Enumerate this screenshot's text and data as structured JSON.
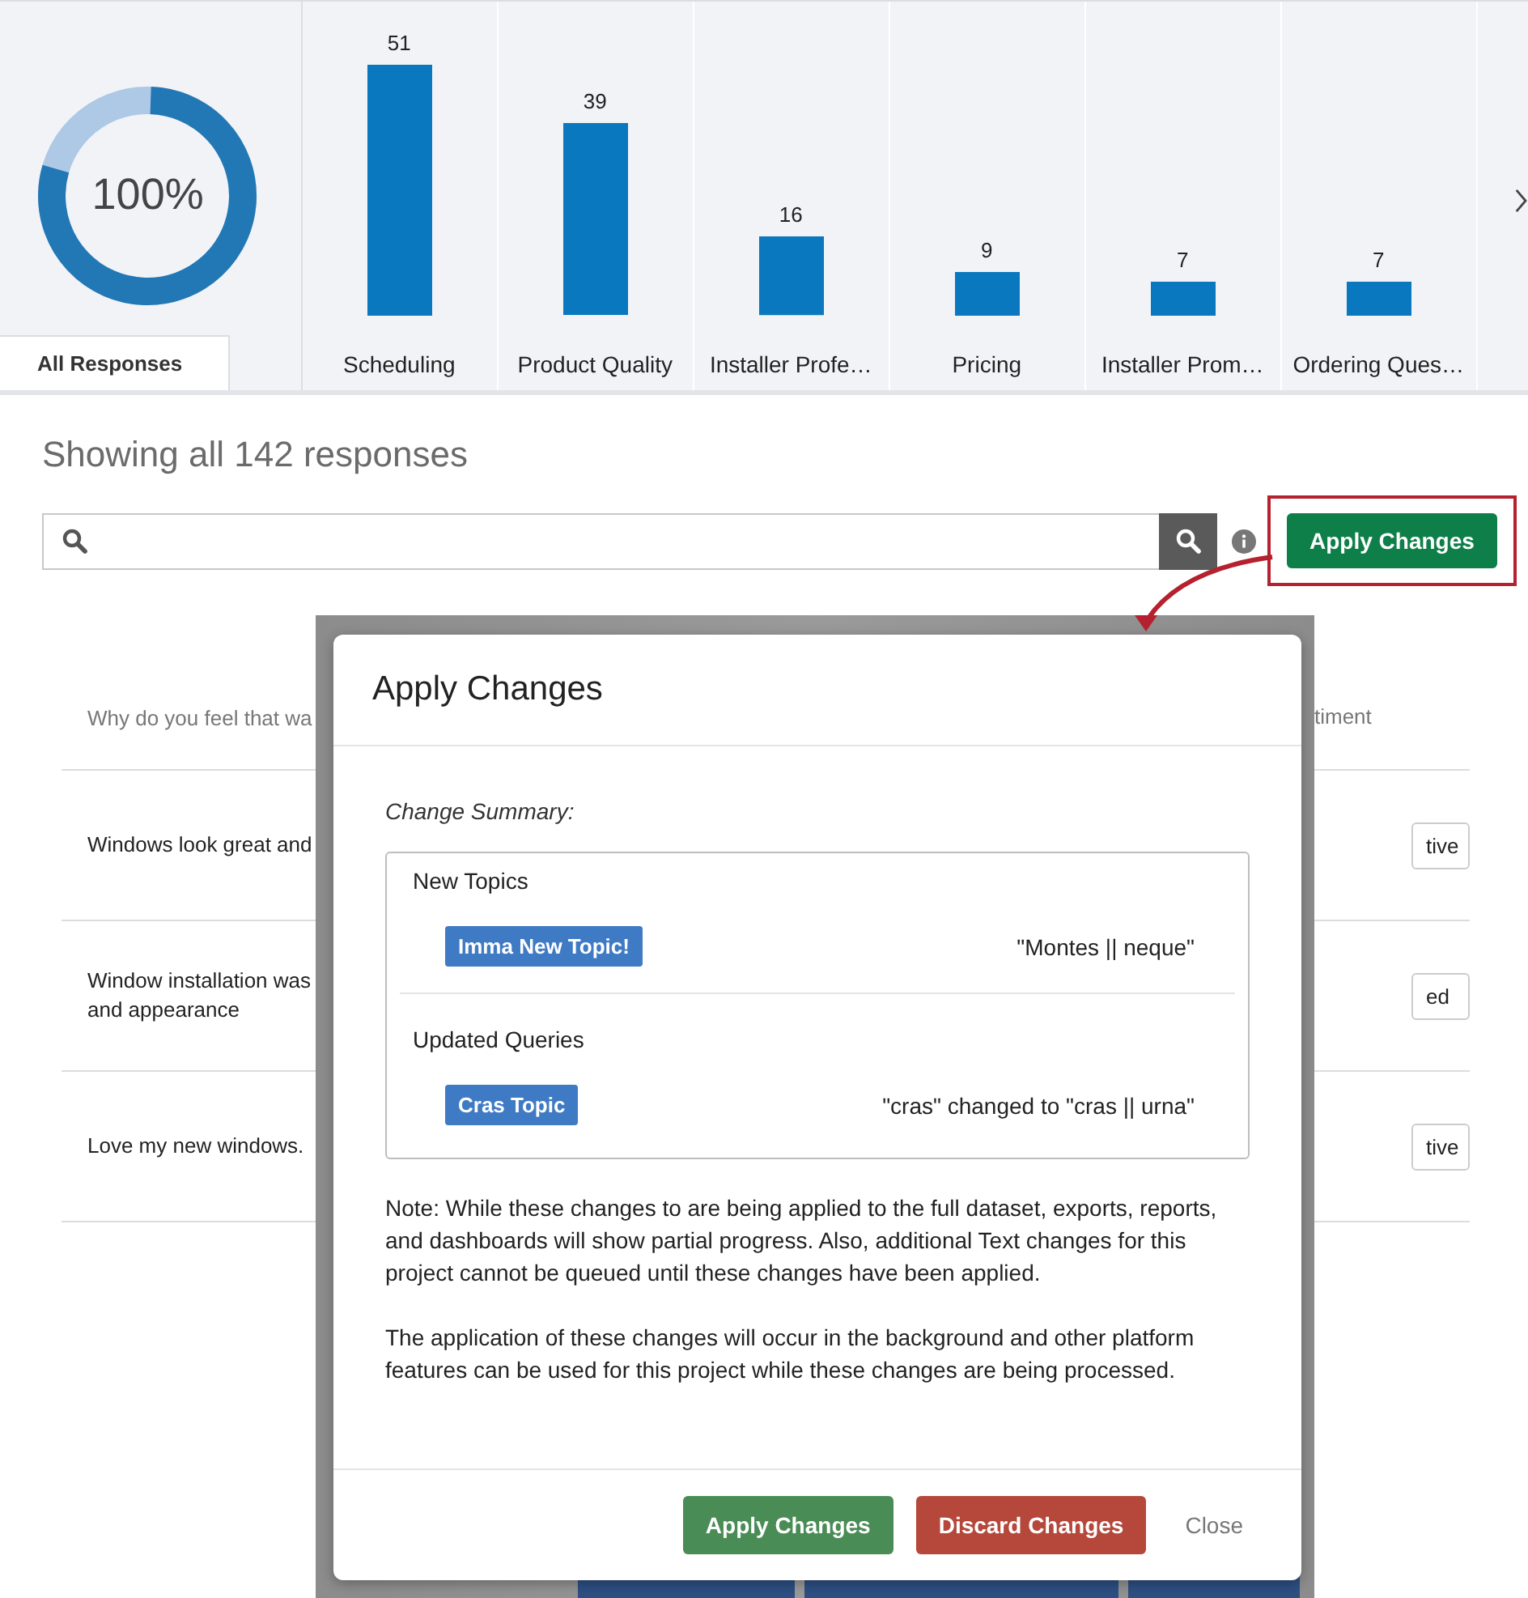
{
  "summary_panel": {
    "donut_label": "100%",
    "tab": {
      "label": "All Responses",
      "selected": true
    }
  },
  "chart_data": {
    "type": "bar",
    "categories": [
      "Scheduling",
      "Product Quality",
      "Installer Profe…",
      "Pricing",
      "Installer Prom…",
      "Ordering Ques…"
    ],
    "values": [
      51,
      39,
      16,
      9,
      7,
      7
    ],
    "data_labels": true
  },
  "heading": "Showing all 142 responses",
  "toolbar": {
    "apply_button": {
      "label": "Apply Changes",
      "highlighted": true
    }
  },
  "table": {
    "columns": [
      "Why do you feel that wa",
      "timent"
    ],
    "rows": [
      {
        "lines": [
          "Windows look great and"
        ],
        "sentiment": "tive"
      },
      {
        "lines": [
          "Window installation was",
          "and appearance"
        ],
        "sentiment": "ed"
      },
      {
        "lines": [
          "Love my new windows."
        ],
        "sentiment": "tive"
      }
    ]
  },
  "modal": {
    "title": "Apply Changes",
    "summary_label": "Change Summary:",
    "sections": [
      {
        "heading": "New Topics",
        "items": [
          {
            "tag": "Imma New Topic!",
            "detail": "\"Montes || neque\""
          }
        ]
      },
      {
        "heading": "Updated Queries",
        "items": [
          {
            "tag": "Cras Topic",
            "detail": "\"cras\" changed to \"cras || urna\""
          }
        ]
      }
    ],
    "notes": [
      "Note: While these changes to are being applied to the full dataset, exports, reports, and dashboards will show partial progress. Also, additional Text changes for this project cannot be queued until these changes have been applied.",
      "The application of these changes will occur in the background and other platform features can be used for this project while these changes are being processed."
    ],
    "buttons": [
      {
        "label": "Apply Changes",
        "kind": "primary"
      },
      {
        "label": "Discard Changes",
        "kind": "danger"
      },
      {
        "label": "Close",
        "kind": "link"
      }
    ]
  }
}
